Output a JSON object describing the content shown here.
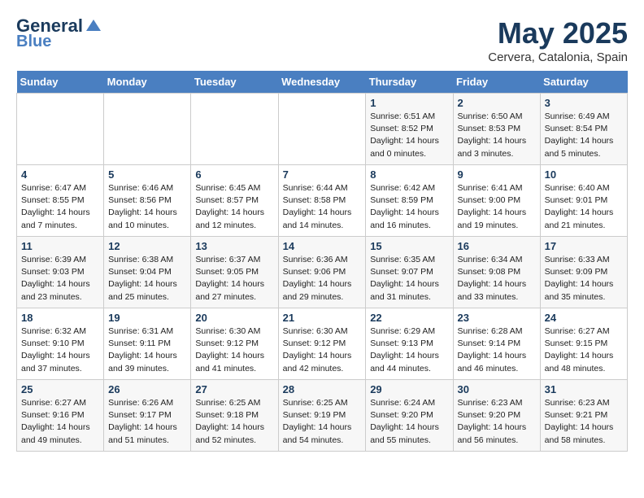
{
  "header": {
    "logo_line1": "General",
    "logo_line2": "Blue",
    "month": "May 2025",
    "location": "Cervera, Catalonia, Spain"
  },
  "days_of_week": [
    "Sunday",
    "Monday",
    "Tuesday",
    "Wednesday",
    "Thursday",
    "Friday",
    "Saturday"
  ],
  "weeks": [
    [
      {
        "day": "",
        "info": ""
      },
      {
        "day": "",
        "info": ""
      },
      {
        "day": "",
        "info": ""
      },
      {
        "day": "",
        "info": ""
      },
      {
        "day": "1",
        "info": "Sunrise: 6:51 AM\nSunset: 8:52 PM\nDaylight: 14 hours and 0 minutes."
      },
      {
        "day": "2",
        "info": "Sunrise: 6:50 AM\nSunset: 8:53 PM\nDaylight: 14 hours and 3 minutes."
      },
      {
        "day": "3",
        "info": "Sunrise: 6:49 AM\nSunset: 8:54 PM\nDaylight: 14 hours and 5 minutes."
      }
    ],
    [
      {
        "day": "4",
        "info": "Sunrise: 6:47 AM\nSunset: 8:55 PM\nDaylight: 14 hours and 7 minutes."
      },
      {
        "day": "5",
        "info": "Sunrise: 6:46 AM\nSunset: 8:56 PM\nDaylight: 14 hours and 10 minutes."
      },
      {
        "day": "6",
        "info": "Sunrise: 6:45 AM\nSunset: 8:57 PM\nDaylight: 14 hours and 12 minutes."
      },
      {
        "day": "7",
        "info": "Sunrise: 6:44 AM\nSunset: 8:58 PM\nDaylight: 14 hours and 14 minutes."
      },
      {
        "day": "8",
        "info": "Sunrise: 6:42 AM\nSunset: 8:59 PM\nDaylight: 14 hours and 16 minutes."
      },
      {
        "day": "9",
        "info": "Sunrise: 6:41 AM\nSunset: 9:00 PM\nDaylight: 14 hours and 19 minutes."
      },
      {
        "day": "10",
        "info": "Sunrise: 6:40 AM\nSunset: 9:01 PM\nDaylight: 14 hours and 21 minutes."
      }
    ],
    [
      {
        "day": "11",
        "info": "Sunrise: 6:39 AM\nSunset: 9:03 PM\nDaylight: 14 hours and 23 minutes."
      },
      {
        "day": "12",
        "info": "Sunrise: 6:38 AM\nSunset: 9:04 PM\nDaylight: 14 hours and 25 minutes."
      },
      {
        "day": "13",
        "info": "Sunrise: 6:37 AM\nSunset: 9:05 PM\nDaylight: 14 hours and 27 minutes."
      },
      {
        "day": "14",
        "info": "Sunrise: 6:36 AM\nSunset: 9:06 PM\nDaylight: 14 hours and 29 minutes."
      },
      {
        "day": "15",
        "info": "Sunrise: 6:35 AM\nSunset: 9:07 PM\nDaylight: 14 hours and 31 minutes."
      },
      {
        "day": "16",
        "info": "Sunrise: 6:34 AM\nSunset: 9:08 PM\nDaylight: 14 hours and 33 minutes."
      },
      {
        "day": "17",
        "info": "Sunrise: 6:33 AM\nSunset: 9:09 PM\nDaylight: 14 hours and 35 minutes."
      }
    ],
    [
      {
        "day": "18",
        "info": "Sunrise: 6:32 AM\nSunset: 9:10 PM\nDaylight: 14 hours and 37 minutes."
      },
      {
        "day": "19",
        "info": "Sunrise: 6:31 AM\nSunset: 9:11 PM\nDaylight: 14 hours and 39 minutes."
      },
      {
        "day": "20",
        "info": "Sunrise: 6:30 AM\nSunset: 9:12 PM\nDaylight: 14 hours and 41 minutes."
      },
      {
        "day": "21",
        "info": "Sunrise: 6:30 AM\nSunset: 9:12 PM\nDaylight: 14 hours and 42 minutes."
      },
      {
        "day": "22",
        "info": "Sunrise: 6:29 AM\nSunset: 9:13 PM\nDaylight: 14 hours and 44 minutes."
      },
      {
        "day": "23",
        "info": "Sunrise: 6:28 AM\nSunset: 9:14 PM\nDaylight: 14 hours and 46 minutes."
      },
      {
        "day": "24",
        "info": "Sunrise: 6:27 AM\nSunset: 9:15 PM\nDaylight: 14 hours and 48 minutes."
      }
    ],
    [
      {
        "day": "25",
        "info": "Sunrise: 6:27 AM\nSunset: 9:16 PM\nDaylight: 14 hours and 49 minutes."
      },
      {
        "day": "26",
        "info": "Sunrise: 6:26 AM\nSunset: 9:17 PM\nDaylight: 14 hours and 51 minutes."
      },
      {
        "day": "27",
        "info": "Sunrise: 6:25 AM\nSunset: 9:18 PM\nDaylight: 14 hours and 52 minutes."
      },
      {
        "day": "28",
        "info": "Sunrise: 6:25 AM\nSunset: 9:19 PM\nDaylight: 14 hours and 54 minutes."
      },
      {
        "day": "29",
        "info": "Sunrise: 6:24 AM\nSunset: 9:20 PM\nDaylight: 14 hours and 55 minutes."
      },
      {
        "day": "30",
        "info": "Sunrise: 6:23 AM\nSunset: 9:20 PM\nDaylight: 14 hours and 56 minutes."
      },
      {
        "day": "31",
        "info": "Sunrise: 6:23 AM\nSunset: 9:21 PM\nDaylight: 14 hours and 58 minutes."
      }
    ]
  ]
}
